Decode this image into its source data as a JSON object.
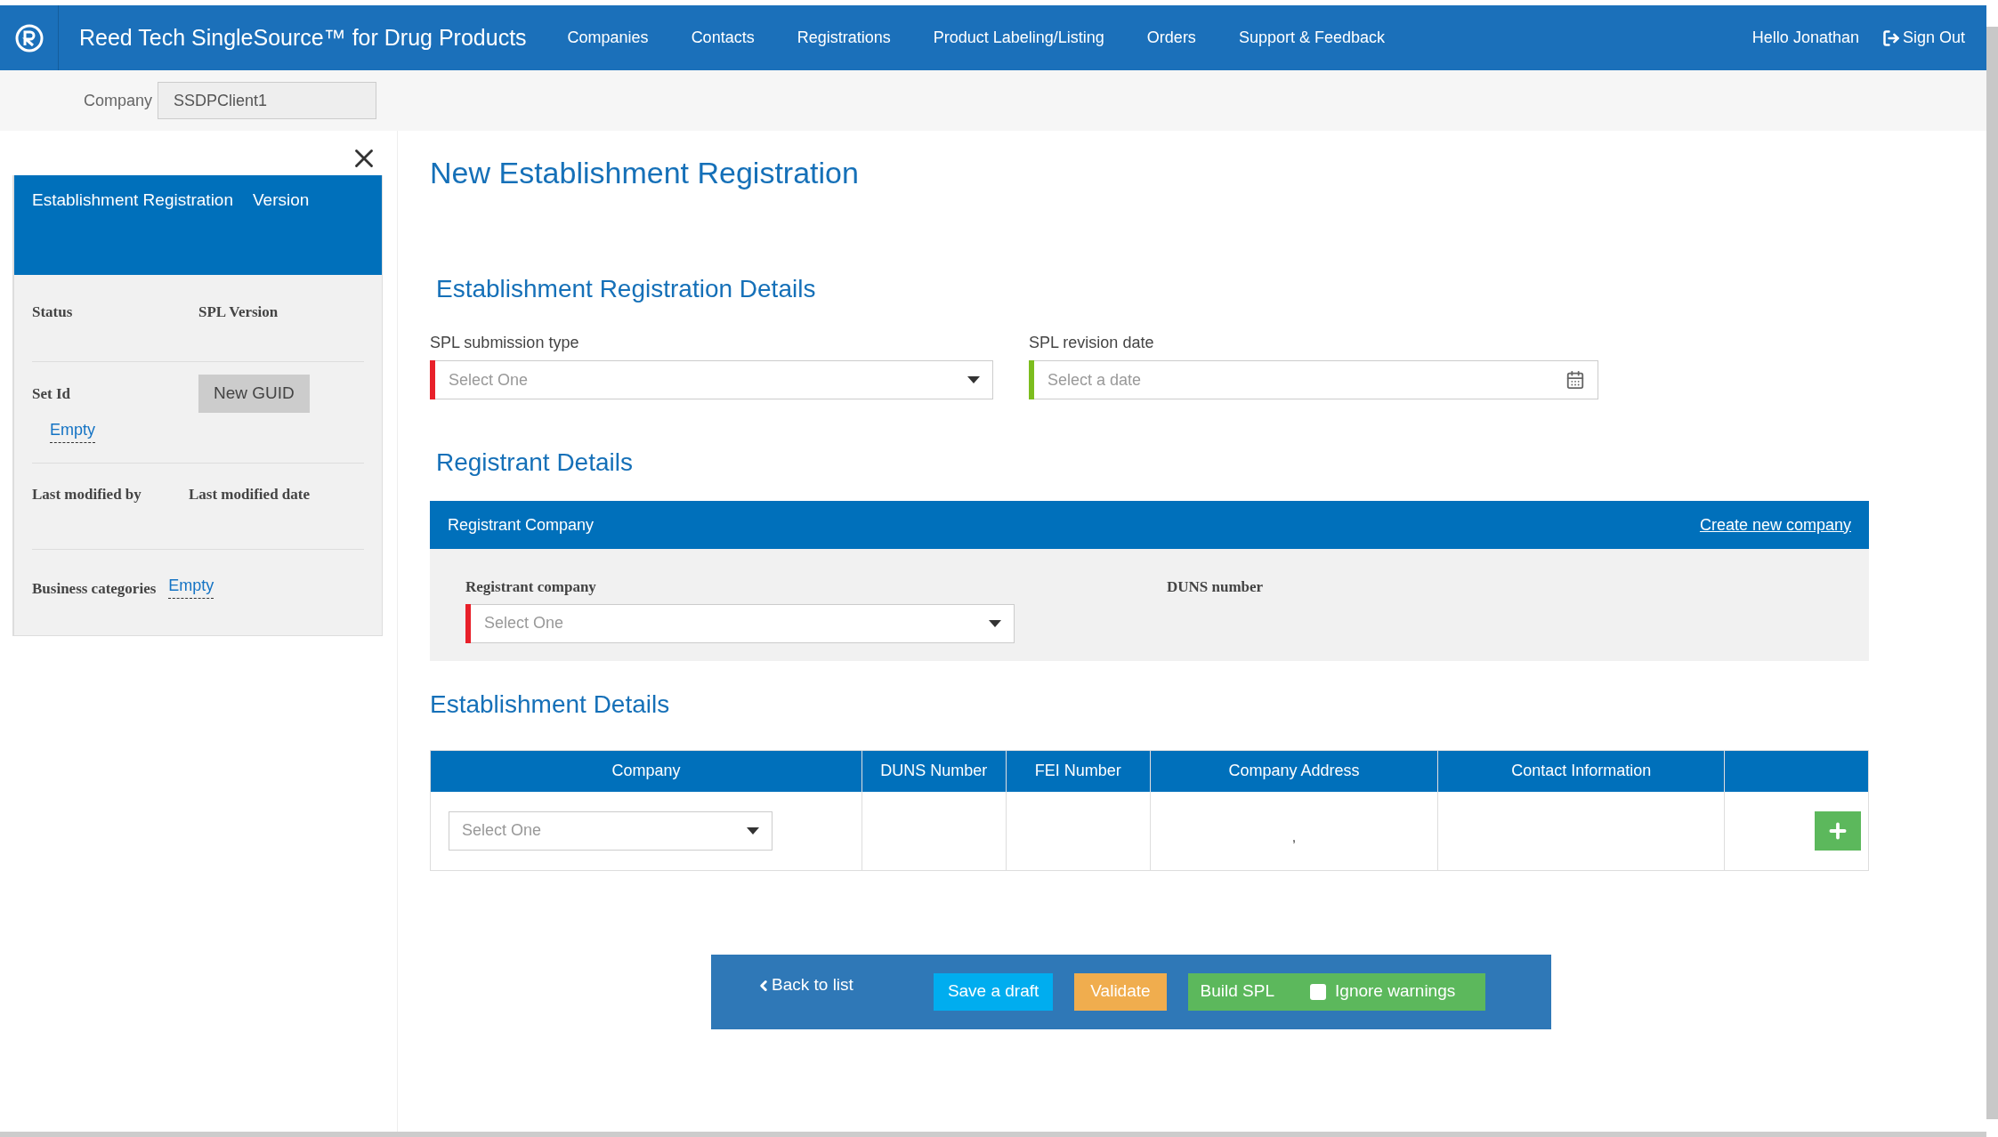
{
  "header": {
    "app_title": "Reed Tech SingleSource™ for Drug Products",
    "nav": [
      "Companies",
      "Contacts",
      "Registrations",
      "Product Labeling/Listing",
      "Orders",
      "Support & Feedback"
    ],
    "greeting": "Hello Jonathan",
    "sign_out": "Sign Out"
  },
  "company_bar": {
    "label": "Company",
    "value": "SSDPClient1"
  },
  "side_panel": {
    "title": "Establishment Registration",
    "version_label": "Version",
    "status_label": "Status",
    "spl_version_label": "SPL Version",
    "set_id_label": "Set Id",
    "new_guid_button": "New GUID",
    "set_id_value": "Empty",
    "modified_by_label": "Last modified by",
    "modified_date_label": "Last modified date",
    "business_categories_label": "Business categories",
    "business_categories_value": "Empty"
  },
  "page_title": "New Establishment Registration",
  "registration_details": {
    "heading": "Establishment Registration Details",
    "fields": [
      {
        "label": "SPL submission type",
        "placeholder": "Select One",
        "kind": "select",
        "color": "#e8202a"
      },
      {
        "label": "SPL revision date",
        "placeholder": "Select a date",
        "kind": "date",
        "color": "#7cbd1e"
      }
    ]
  },
  "registrant": {
    "heading": "Registrant Details",
    "panel_title": "Registrant Company",
    "create_link": "Create new company",
    "company_label": "Registrant company",
    "company_field": {
      "placeholder": "Select One",
      "color": "#e8202a"
    },
    "duns_label": "DUNS number"
  },
  "establishment": {
    "heading": "Establishment Details",
    "columns": [
      "Company",
      "DUNS Number",
      "FEI Number",
      "Company Address",
      "Contact Information"
    ],
    "rows": [
      {
        "company_placeholder": "Select One",
        "address": ","
      }
    ]
  },
  "footer": {
    "back": "Back to list",
    "save": "Save a draft",
    "validate": "Validate",
    "build": "Build SPL",
    "ignore_warnings": {
      "label": "Ignore warnings",
      "checked": false
    }
  }
}
